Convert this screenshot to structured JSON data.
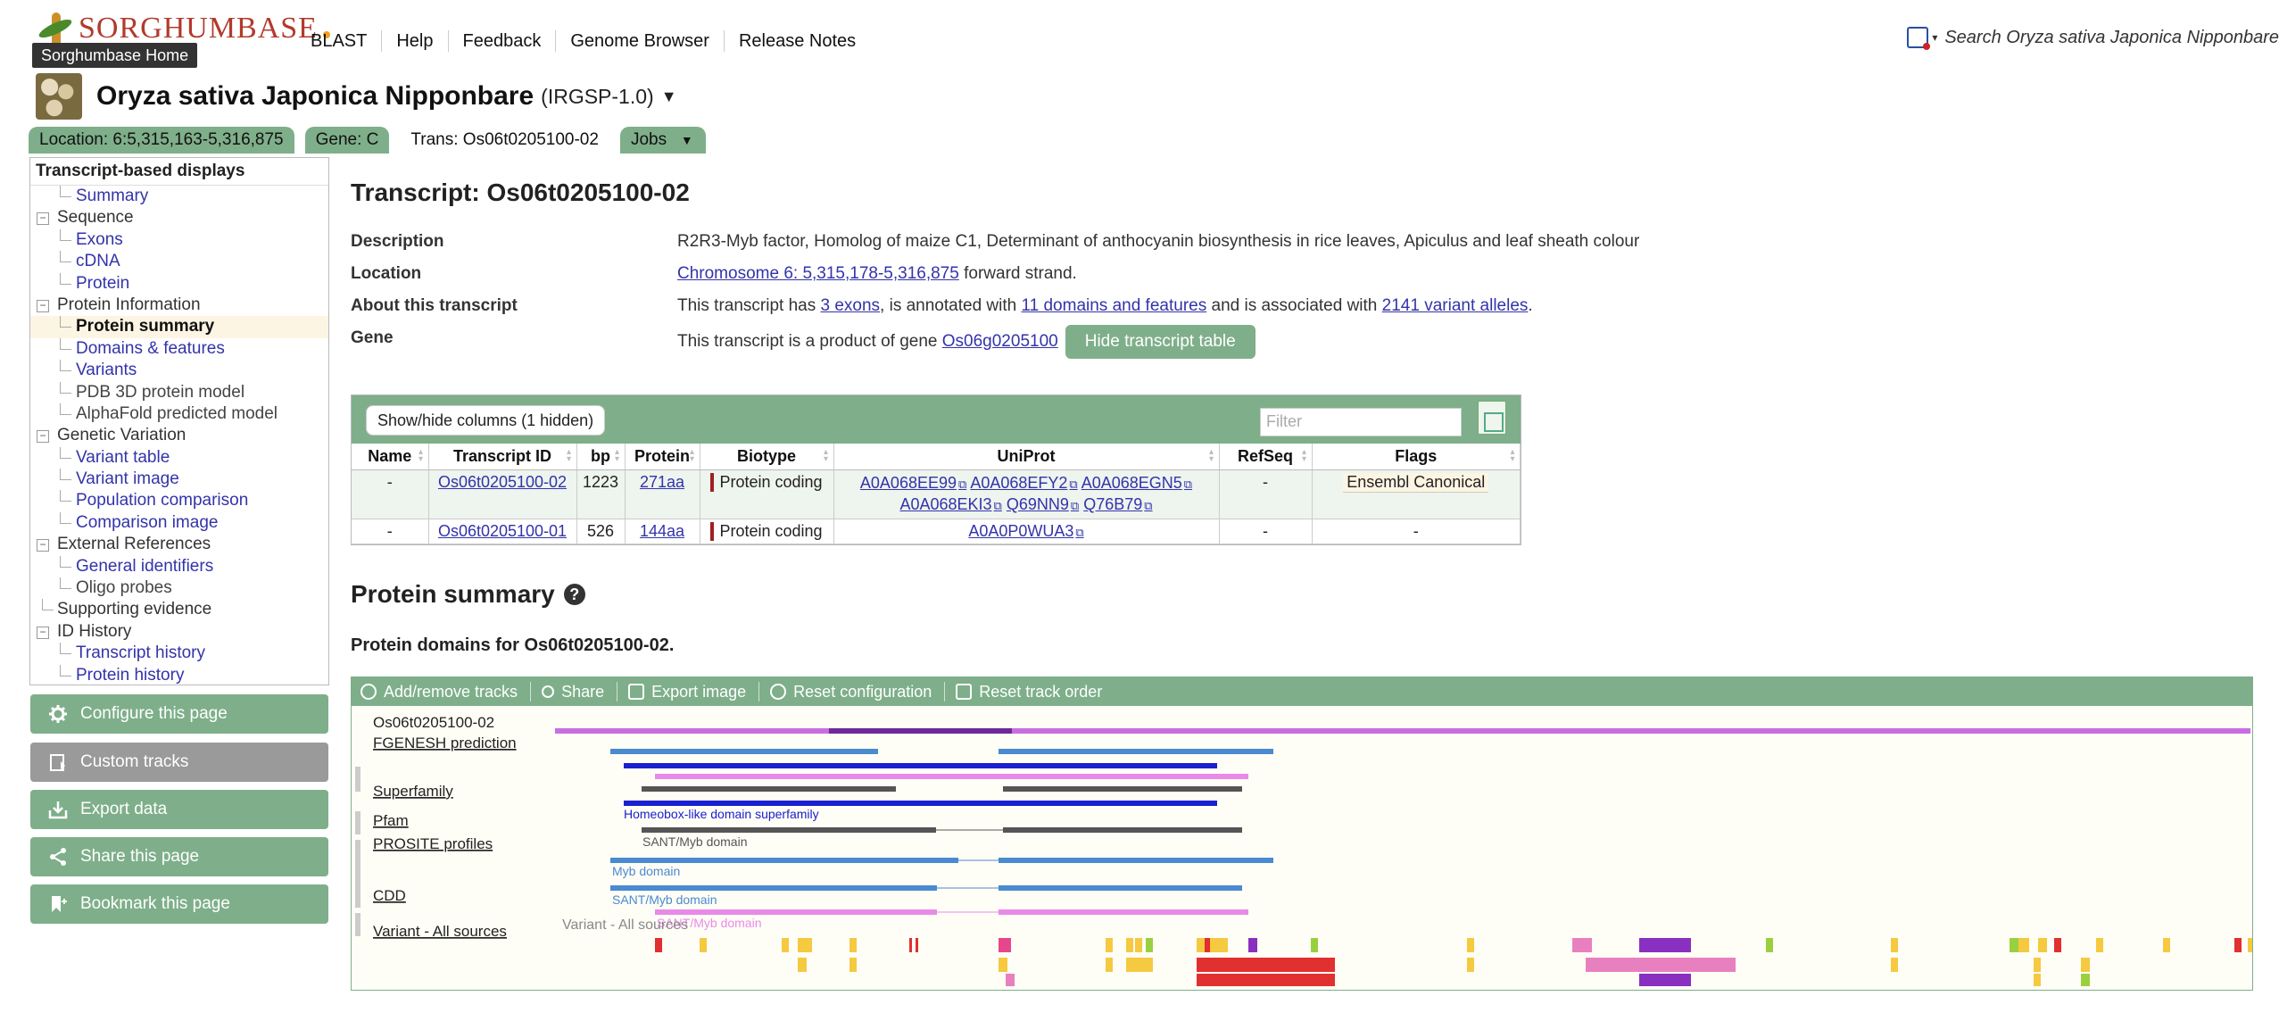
{
  "masthead": {
    "logo_text": "SORGHUMBASE",
    "tooltip": "Sorghumbase Home",
    "nav": [
      "BLAST",
      "Help",
      "Feedback",
      "Genome Browser",
      "Release Notes"
    ],
    "search_placeholder": "Search Oryza sativa Japonica Nipponbare"
  },
  "species": {
    "name": "Oryza sativa Japonica Nipponbare",
    "assembly": "(IRGSP-1.0)",
    "caret": "▼"
  },
  "tabs": {
    "location": "Location: 6:5,315,163-5,316,875",
    "gene": "Gene: C",
    "trans": "Trans: Os06t0205100-02",
    "jobs": "Jobs",
    "jobs_caret": "▼"
  },
  "leftmenu": {
    "header": "Transcript-based displays",
    "items": [
      {
        "label": "Summary",
        "level": 2,
        "style": "link"
      },
      {
        "label": "Sequence",
        "level": 1
      },
      {
        "label": "Exons",
        "level": 2,
        "style": "link"
      },
      {
        "label": "cDNA",
        "level": 2,
        "style": "link"
      },
      {
        "label": "Protein",
        "level": 2,
        "style": "link"
      },
      {
        "label": "Protein Information",
        "level": 1
      },
      {
        "label": "Protein summary",
        "level": 2,
        "style": "selected"
      },
      {
        "label": "Domains & features",
        "level": 2,
        "style": "link"
      },
      {
        "label": "Variants",
        "level": 2,
        "style": "link"
      },
      {
        "label": "PDB 3D protein model",
        "level": 2,
        "style": "disabled"
      },
      {
        "label": "AlphaFold predicted model",
        "level": 2,
        "style": "disabled"
      },
      {
        "label": "Genetic Variation",
        "level": 1
      },
      {
        "label": "Variant table",
        "level": 2,
        "style": "link"
      },
      {
        "label": "Variant image",
        "level": 2,
        "style": "link"
      },
      {
        "label": "Population comparison",
        "level": 2,
        "style": "link"
      },
      {
        "label": "Comparison image",
        "level": 2,
        "style": "link"
      },
      {
        "label": "External References",
        "level": 1
      },
      {
        "label": "General identifiers",
        "level": 2,
        "style": "link"
      },
      {
        "label": "Oligo probes",
        "level": 2,
        "style": "disabled"
      },
      {
        "label": "Supporting evidence",
        "level": 0
      },
      {
        "label": "ID History",
        "level": 1
      },
      {
        "label": "Transcript history",
        "level": 2,
        "style": "link"
      },
      {
        "label": "Protein history",
        "level": 2,
        "style": "link"
      }
    ]
  },
  "buttons": {
    "configure": "Configure this page",
    "custom_tracks": "Custom tracks",
    "export": "Export data",
    "share": "Share this page",
    "bookmark": "Bookmark this page"
  },
  "transcript": {
    "title": "Transcript: Os06t0205100-02",
    "description_label": "Description",
    "description": "R2R3-Myb factor, Homolog of maize C1, Determinant of anthocyanin biosynthesis in rice leaves, Apiculus and leaf sheath colour",
    "location_label": "Location",
    "location_link": "Chromosome 6: 5,315,178-5,316,875",
    "location_suffix": " forward strand.",
    "about_label": "About this transcript",
    "about_pre": "This transcript has ",
    "about_exons": "3 exons",
    "about_mid1": ", is annotated with ",
    "about_domains": "11 domains and features",
    "about_mid2": " and is associated with ",
    "about_variants": "2141 variant alleles",
    "about_end": ".",
    "gene_label": "Gene",
    "gene_pre": "This transcript is a product of gene ",
    "gene_link": "Os06g0205100",
    "hide_table": "Hide transcript table"
  },
  "table": {
    "showhide": "Show/hide columns (1 hidden)",
    "filter_placeholder": "Filter",
    "headers": [
      "Name",
      "Transcript ID",
      "bp",
      "Protein",
      "Biotype",
      "UniProt",
      "RefSeq",
      "Flags"
    ],
    "rows": [
      {
        "name": "-",
        "id": "Os06t0205100-02",
        "bp": "1223",
        "protein": "271aa",
        "biotype": "Protein coding",
        "uniprot": [
          "A0A068EE99",
          "A0A068EFY2",
          "A0A068EGN5",
          "A0A068EKI3",
          "Q69NN9",
          "Q76B79"
        ],
        "refseq": "-",
        "flags": "Ensembl Canonical"
      },
      {
        "name": "-",
        "id": "Os06t0205100-01",
        "bp": "526",
        "protein": "144aa",
        "biotype": "Protein coding",
        "uniprot": [
          "A0A0P0WUA3"
        ],
        "refseq": "-",
        "flags": "-"
      }
    ]
  },
  "protein_summary": {
    "title": "Protein summary",
    "help": "?",
    "domains_title": "Protein domains for Os06t0205100-02."
  },
  "browser": {
    "toolbar": [
      "Add/remove tracks",
      "Share",
      "Export image",
      "Reset configuration",
      "Reset track order"
    ],
    "tracks": {
      "transcript": "Os06t0205100-02",
      "fgenesh": "FGENESH prediction",
      "superfamily": "Superfamily",
      "superfamily_feature": "Homeobox-like domain superfamily",
      "pfam": "Pfam",
      "pfam_feature": "SANT/Myb domain",
      "prosite": "PROSITE profiles",
      "prosite_feature1": "Myb domain",
      "prosite_feature2": "SANT/Myb domain",
      "cdd": "CDD",
      "cdd_feature": "SANT/Myb domain",
      "variant": "Variant - All sources",
      "variant_inner": "Variant - All sources"
    },
    "colors": {
      "transcript": "#c86ee0",
      "transcript_dark": "#6a2a9a",
      "fgenesh_light": "#4a8ad0",
      "superfamily": "#1a20d0",
      "pfam": "#555555",
      "prosite": "#4a8ad0",
      "cdd": "#e88ae8"
    }
  }
}
